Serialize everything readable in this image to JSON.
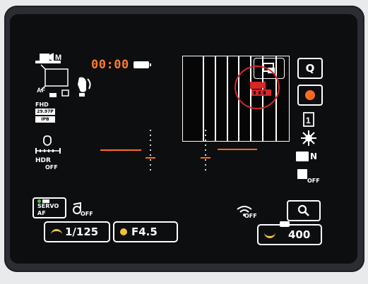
{
  "screen": {
    "timecode": "00:00",
    "record_state": "ready",
    "accent_color": "#ff7a2e",
    "record_dot_color": "#ff6a20",
    "annotation_circle_color": "#d6262a"
  },
  "left_panel": {
    "mode_icon": "movie-mode-m-icon",
    "af_icon": "af-frame-icon",
    "stabilizer_icon": "image-stabilizer-icon",
    "quality_labels": [
      "FHD",
      "29.97P",
      "IPB"
    ],
    "audio_icon": "audio-level-icon",
    "hdr_label": "HDR",
    "hdr_state": "OFF"
  },
  "right_panel": {
    "q_label": "Q",
    "drive_icon": "single-shot-icon",
    "wb_icon": "auto-white-balance-icon",
    "noise_label": "N",
    "off_label": "OFF"
  },
  "bottom_bar": {
    "af_mode": "SERVO AF",
    "servo_state": "OFF",
    "wifi_state": "OFF",
    "shutter": "1/125",
    "aperture": "F4.5",
    "iso": "400"
  }
}
